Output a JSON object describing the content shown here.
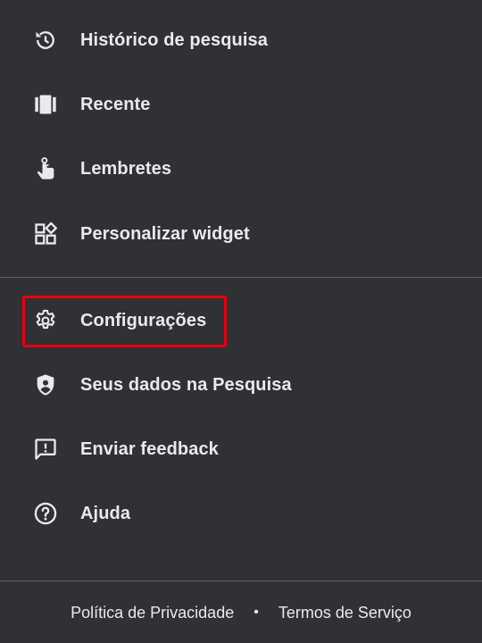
{
  "menu": {
    "items": [
      {
        "label": "Histórico de pesquisa",
        "icon": "history-icon"
      },
      {
        "label": "Recente",
        "icon": "recent-cards-icon"
      },
      {
        "label": "Lembretes",
        "icon": "reminder-hand-icon"
      },
      {
        "label": "Personalizar widget",
        "icon": "widgets-icon"
      },
      {
        "label": "Configurações",
        "icon": "gear-icon"
      },
      {
        "label": "Seus dados na Pesquisa",
        "icon": "shield-person-icon"
      },
      {
        "label": "Enviar feedback",
        "icon": "feedback-icon"
      },
      {
        "label": "Ajuda",
        "icon": "help-icon"
      }
    ]
  },
  "footer": {
    "privacy": "Política de Privacidade",
    "separator": "•",
    "terms": "Termos de Serviço"
  },
  "colors": {
    "background": "#303134",
    "text": "#e8eaed",
    "divider": "#5f6368",
    "highlight": "#e8000b"
  }
}
